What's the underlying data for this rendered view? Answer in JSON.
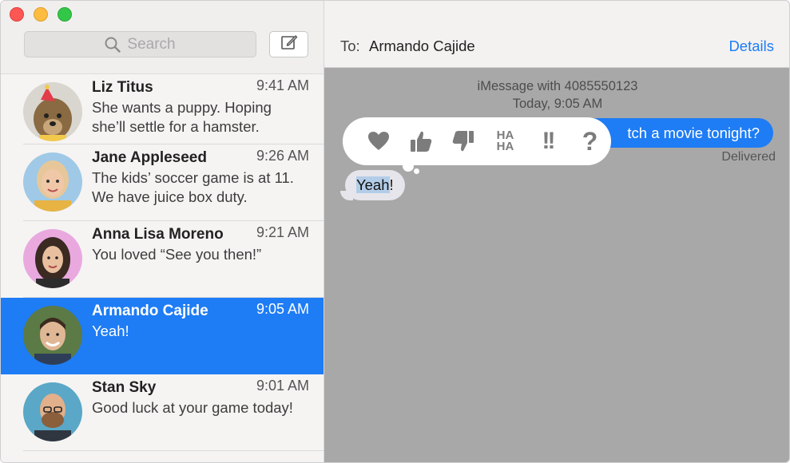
{
  "window": {
    "controls": [
      "close",
      "minimize",
      "maximize"
    ]
  },
  "sidebar": {
    "search_placeholder": "Search",
    "compose_icon": "compose-icon",
    "conversations": [
      {
        "name": "Liz Titus",
        "time": "9:41 AM",
        "preview": "She wants a puppy. Hoping she’ll settle for a hamster.",
        "avatar": "dog-with-party-hat"
      },
      {
        "name": "Jane Appleseed",
        "time": "9:26 AM",
        "preview": "The kids’ soccer game is at 11. We have juice box duty.",
        "avatar": "woman-blonde"
      },
      {
        "name": "Anna Lisa Moreno",
        "time": "9:21 AM",
        "preview": "You loved “See you then!”",
        "avatar": "woman-dark-hair"
      },
      {
        "name": "Armando Cajide",
        "time": "9:05 AM",
        "preview": "Yeah!",
        "avatar": "man-smiling",
        "selected": true
      },
      {
        "name": "Stan Sky",
        "time": "9:01 AM",
        "preview": "Good luck at your game today!",
        "avatar": "man-glasses-beard"
      }
    ]
  },
  "conversation": {
    "to_label": "To:",
    "to_name": "Armando Cajide",
    "details_label": "Details",
    "service_line": "iMessage with 4085550123",
    "date_line": "Today, 9:05 AM",
    "outgoing_text": "tch a movie tonight?",
    "delivered_label": "Delivered",
    "incoming_highlight": "Yeah",
    "incoming_rest": "!",
    "tapback": {
      "items": [
        "heart-icon",
        "thumbs-up-icon",
        "thumbs-down-icon",
        "haha",
        "exclamation",
        "question"
      ],
      "haha_top": "HA",
      "haha_bottom": "HA",
      "exclaim": "!!",
      "question": "?"
    }
  },
  "colors": {
    "accent": "#1e7cf5",
    "transcript_bg": "#a8a8a8",
    "incoming_bubble": "#e6e5eb"
  }
}
